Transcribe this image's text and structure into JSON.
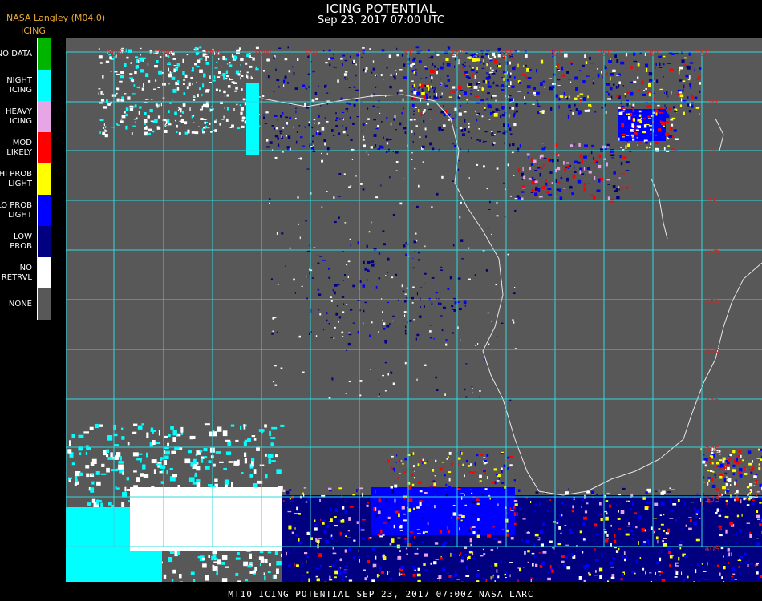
{
  "header": {
    "title": "ICING POTENTIAL",
    "subtitle": "Sep 23, 2017 07:00 UTC",
    "producer": "NASA Langley (M04.0)",
    "product": "ICING"
  },
  "legend": [
    {
      "label": "NO DATA",
      "color": "#00b400"
    },
    {
      "label": "NIGHT\nICING",
      "color": "#00ffff"
    },
    {
      "label": "HEAVY\nICING",
      "color": "#e6a6e6"
    },
    {
      "label": "MOD\nLIKELY",
      "color": "#ff0000"
    },
    {
      "label": "HI PROB\nLIGHT",
      "color": "#ffff00"
    },
    {
      "label": "LO PROB\nLIGHT",
      "color": "#0000ff"
    },
    {
      "label": "LOW\nPROB",
      "color": "#000080"
    },
    {
      "label": "NO\nRETRVL",
      "color": "#ffffff"
    },
    {
      "label": "NONE",
      "color": "#585858"
    }
  ],
  "map": {
    "lon_labels": [
      "20W",
      "20W",
      "15W",
      "10W",
      "5W",
      "0",
      "5E",
      "10E",
      "15E",
      "20E",
      "25E",
      "30E",
      "35E"
    ],
    "lat_labels": [
      "5N",
      "0",
      "5S",
      "10S",
      "15S",
      "20S",
      "25S",
      "30S",
      "35S",
      "40S"
    ],
    "grid_color": "#30d8e0",
    "label_color": "#c03030"
  },
  "footer": "MT10  ICING POTENTIAL   SEP 23, 2017 07:00Z   NASA LARC"
}
